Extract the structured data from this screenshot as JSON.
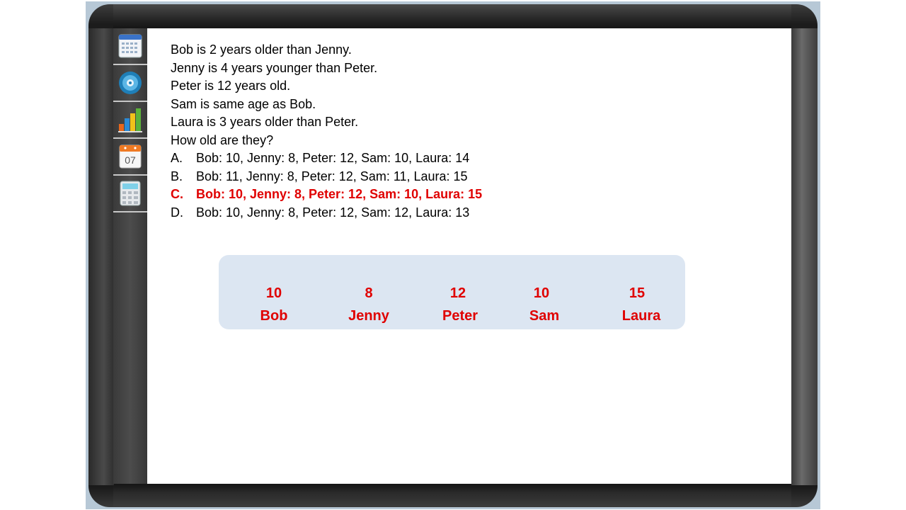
{
  "question": {
    "lines": [
      "Bob is 2 years older than Jenny.",
      "Jenny is 4 years younger than Peter.",
      "Peter is 12 years old.",
      "Sam is same age as Bob.",
      "Laura is 3 years older than Peter.",
      "How old are they?"
    ],
    "options": [
      {
        "letter": "A.",
        "text": "Bob: 10, Jenny: 8, Peter: 12, Sam: 10, Laura: 14"
      },
      {
        "letter": "B.",
        "text": "Bob: 11, Jenny: 8, Peter: 12, Sam: 11, Laura: 15"
      },
      {
        "letter": "C.",
        "text": "Bob: 10, Jenny: 8, Peter: 12, Sam: 10, Laura: 15",
        "correct": true
      },
      {
        "letter": "D.",
        "text": "Bob: 10, Jenny: 8, Peter: 12, Sam: 12, Laura: 13"
      }
    ]
  },
  "answers": [
    {
      "age": "10",
      "name": "Bob"
    },
    {
      "age": "8",
      "name": "Jenny"
    },
    {
      "age": "12",
      "name": "Peter"
    },
    {
      "age": "10",
      "name": "Sam"
    },
    {
      "age": "15",
      "name": "Laura"
    }
  ],
  "toolbar": {
    "icons": [
      "calendar-grid-icon",
      "disc-icon",
      "bar-chart-icon",
      "date-07-icon",
      "calculator-icon"
    ],
    "date_label": "07"
  },
  "colors": {
    "correct": "#e00000",
    "panel": "#dce6f2",
    "frame": "#1c1c1c"
  }
}
